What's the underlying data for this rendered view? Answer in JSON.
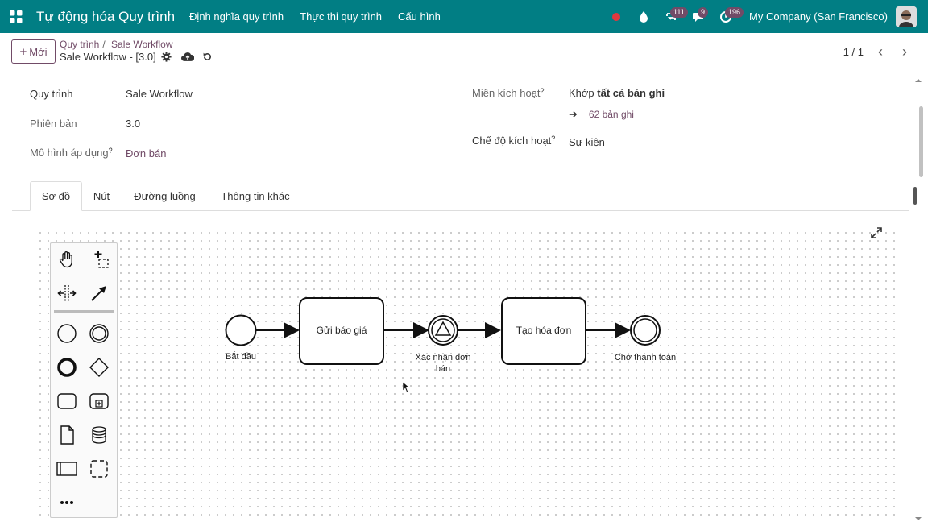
{
  "navbar": {
    "app_title": "Tự động hóa Quy trình",
    "menu": [
      "Định nghĩa quy trình",
      "Thực thi quy trình",
      "Cấu hình"
    ],
    "activity_badge": "111",
    "messages_badge": "9",
    "clock_badge": "196",
    "company": "My Company (San Francisco)"
  },
  "control": {
    "new_label": "Mới",
    "breadcrumb": [
      "Quy trình",
      "Sale Workflow"
    ],
    "record_title": "Sale Workflow - [3.0]",
    "pager": "1 / 1"
  },
  "form": {
    "process_label": "Quy trình",
    "process_value": "Sale Workflow",
    "version_label": "Phiên bản",
    "version_value": "3.0",
    "model_label": "Mô hình áp dụng",
    "model_value": "Đơn bán",
    "domain_label": "Miền kích hoạt",
    "domain_value_prefix": "Khớp",
    "domain_value_bold": "tất cả bản ghi",
    "records_link": "62 bản ghi",
    "trigger_label": "Chế độ kích hoạt",
    "trigger_value": "Sự kiện",
    "help_mark": "?"
  },
  "tabs": [
    "Sơ đồ",
    "Nút",
    "Đường luồng",
    "Thông tin khác"
  ],
  "diagram": {
    "start_label": "Bắt đầu",
    "task1_label": "Gửi báo giá",
    "event_label_1": "Xác nhận đơn",
    "event_label_2": "bán",
    "task2_label": "Tạo hóa đơn",
    "end_label": "Chờ thanh toán"
  },
  "palette_tools": [
    "hand-tool",
    "lasso-tool",
    "space-tool",
    "connect-tool",
    "start-event",
    "intermediate-event",
    "end-event",
    "gateway",
    "task",
    "subprocess",
    "data-object",
    "data-store",
    "pool",
    "group",
    "more"
  ],
  "colors": {
    "navbar": "#017e84",
    "accent": "#714b67"
  }
}
